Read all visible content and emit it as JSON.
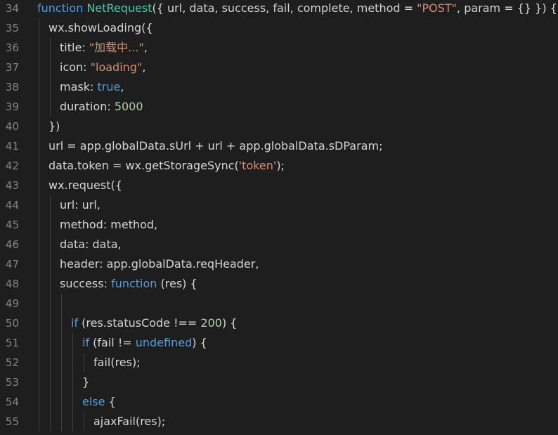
{
  "editor": {
    "lines": [
      {
        "n": "34",
        "indent": 0,
        "tokens": [
          [
            "kw",
            "function"
          ],
          [
            "p",
            " "
          ],
          [
            "fn",
            "NetRequest"
          ],
          [
            "p",
            "({ url, data, success, fail, complete, method = "
          ],
          [
            "str",
            "\"POST\""
          ],
          [
            "p",
            ", param = {} }) {"
          ]
        ]
      },
      {
        "n": "35",
        "indent": 1,
        "tokens": [
          [
            "p",
            "wx.showLoading({"
          ]
        ]
      },
      {
        "n": "36",
        "indent": 2,
        "tokens": [
          [
            "p",
            "title: "
          ],
          [
            "str",
            "\"加载中...\""
          ],
          [
            "p",
            ","
          ]
        ]
      },
      {
        "n": "37",
        "indent": 2,
        "tokens": [
          [
            "p",
            "icon: "
          ],
          [
            "str",
            "\"loading\""
          ],
          [
            "p",
            ","
          ]
        ]
      },
      {
        "n": "38",
        "indent": 2,
        "tokens": [
          [
            "p",
            "mask: "
          ],
          [
            "kw",
            "true"
          ],
          [
            "p",
            ","
          ]
        ]
      },
      {
        "n": "39",
        "indent": 2,
        "tokens": [
          [
            "p",
            "duration: "
          ],
          [
            "num",
            "5000"
          ]
        ]
      },
      {
        "n": "40",
        "indent": 1,
        "tokens": [
          [
            "p",
            "})"
          ]
        ]
      },
      {
        "n": "41",
        "indent": 1,
        "tokens": [
          [
            "p",
            "url = app.globalData.sUrl + url + app.globalData.sDParam;"
          ]
        ]
      },
      {
        "n": "42",
        "indent": 1,
        "tokens": [
          [
            "p",
            "data.token = wx.getStorageSync("
          ],
          [
            "str",
            "'token'"
          ],
          [
            "p",
            ");"
          ]
        ]
      },
      {
        "n": "43",
        "indent": 1,
        "tokens": [
          [
            "p",
            "wx.request({"
          ]
        ]
      },
      {
        "n": "44",
        "indent": 2,
        "tokens": [
          [
            "p",
            "url: url,"
          ]
        ]
      },
      {
        "n": "45",
        "indent": 2,
        "tokens": [
          [
            "p",
            "method: method,"
          ]
        ]
      },
      {
        "n": "46",
        "indent": 2,
        "tokens": [
          [
            "p",
            "data: data,"
          ]
        ]
      },
      {
        "n": "47",
        "indent": 2,
        "tokens": [
          [
            "p",
            "header: app.globalData.reqHeader,"
          ]
        ]
      },
      {
        "n": "48",
        "indent": 2,
        "tokens": [
          [
            "p",
            "success: "
          ],
          [
            "kw",
            "function"
          ],
          [
            "p",
            " (res) {"
          ]
        ]
      },
      {
        "n": "49",
        "indent": 3,
        "tokens": []
      },
      {
        "n": "50",
        "indent": 3,
        "tokens": [
          [
            "kw",
            "if"
          ],
          [
            "p",
            " (res.statusCode !== "
          ],
          [
            "num",
            "200"
          ],
          [
            "p",
            ") {"
          ]
        ]
      },
      {
        "n": "51",
        "indent": 4,
        "tokens": [
          [
            "kw",
            "if"
          ],
          [
            "p",
            " (fail != "
          ],
          [
            "kw",
            "undefined"
          ],
          [
            "p",
            ") {"
          ]
        ]
      },
      {
        "n": "52",
        "indent": 5,
        "tokens": [
          [
            "p",
            "fail(res);"
          ]
        ]
      },
      {
        "n": "53",
        "indent": 4,
        "tokens": [
          [
            "p",
            "}"
          ]
        ]
      },
      {
        "n": "54",
        "indent": 4,
        "tokens": [
          [
            "kw",
            "else"
          ],
          [
            "p",
            " {"
          ]
        ]
      },
      {
        "n": "55",
        "indent": 5,
        "tokens": [
          [
            "p",
            "ajaxFail(res);"
          ]
        ]
      }
    ]
  }
}
